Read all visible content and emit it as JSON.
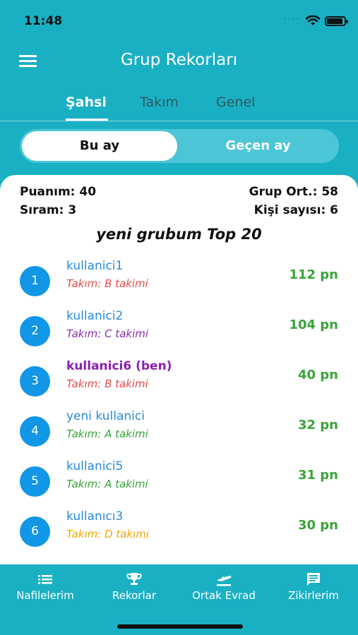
{
  "status": {
    "time": "11:48"
  },
  "header": {
    "title": "Grup Rekorları"
  },
  "tabs": [
    {
      "label": "Şahsi",
      "active": true
    },
    {
      "label": "Takım",
      "active": false
    },
    {
      "label": "Genel",
      "active": false
    }
  ],
  "segment": {
    "left": "Bu ay",
    "right": "Geçen ay",
    "selected": "Bu ay"
  },
  "stats": {
    "puanim": "Puanım: 40",
    "grup_ort": "Grup Ort.: 58",
    "siram": "Sıram: 3",
    "kisi_sayisi": "Kişi sayısı: 6"
  },
  "group_title": "yeni grubum Top 20",
  "leaderboard": [
    {
      "rank": "1",
      "name": "kullanici1",
      "team": "Takım: B takimi",
      "team_color": "#e84a4a",
      "points": "112 pn",
      "is_me": false
    },
    {
      "rank": "2",
      "name": "kullanici2",
      "team": "Takım: C takimi",
      "team_color": "#8b2fb0",
      "points": "104 pn",
      "is_me": false
    },
    {
      "rank": "3",
      "name": "kullanici6 (ben)",
      "team": "Takım: B takimi",
      "team_color": "#e84a4a",
      "points": "40 pn",
      "is_me": true
    },
    {
      "rank": "4",
      "name": "yeni kullanici",
      "team": "Takım: A takimi",
      "team_color": "#3aa33a",
      "points": "32 pn",
      "is_me": false
    },
    {
      "rank": "5",
      "name": "kullanici5",
      "team": "Takım: A takimi",
      "team_color": "#3aa33a",
      "points": "31 pn",
      "is_me": false
    },
    {
      "rank": "6",
      "name": "kullanıcı3",
      "team": "Takım: D takımı",
      "team_color": "#f0a500",
      "points": "30 pn",
      "is_me": false
    }
  ],
  "colors": {
    "primary": "#1ab0c4",
    "rank_badge": "#1296e6",
    "points": "#3aa33a",
    "me": "#8b1fae"
  },
  "bottom_nav": [
    {
      "label": "Nafilelerim",
      "icon": "list-icon"
    },
    {
      "label": "Rekorlar",
      "icon": "trophy-icon"
    },
    {
      "label": "Ortak Evrad",
      "icon": "airplane-icon"
    },
    {
      "label": "Zikirlerim",
      "icon": "chat-icon"
    }
  ]
}
